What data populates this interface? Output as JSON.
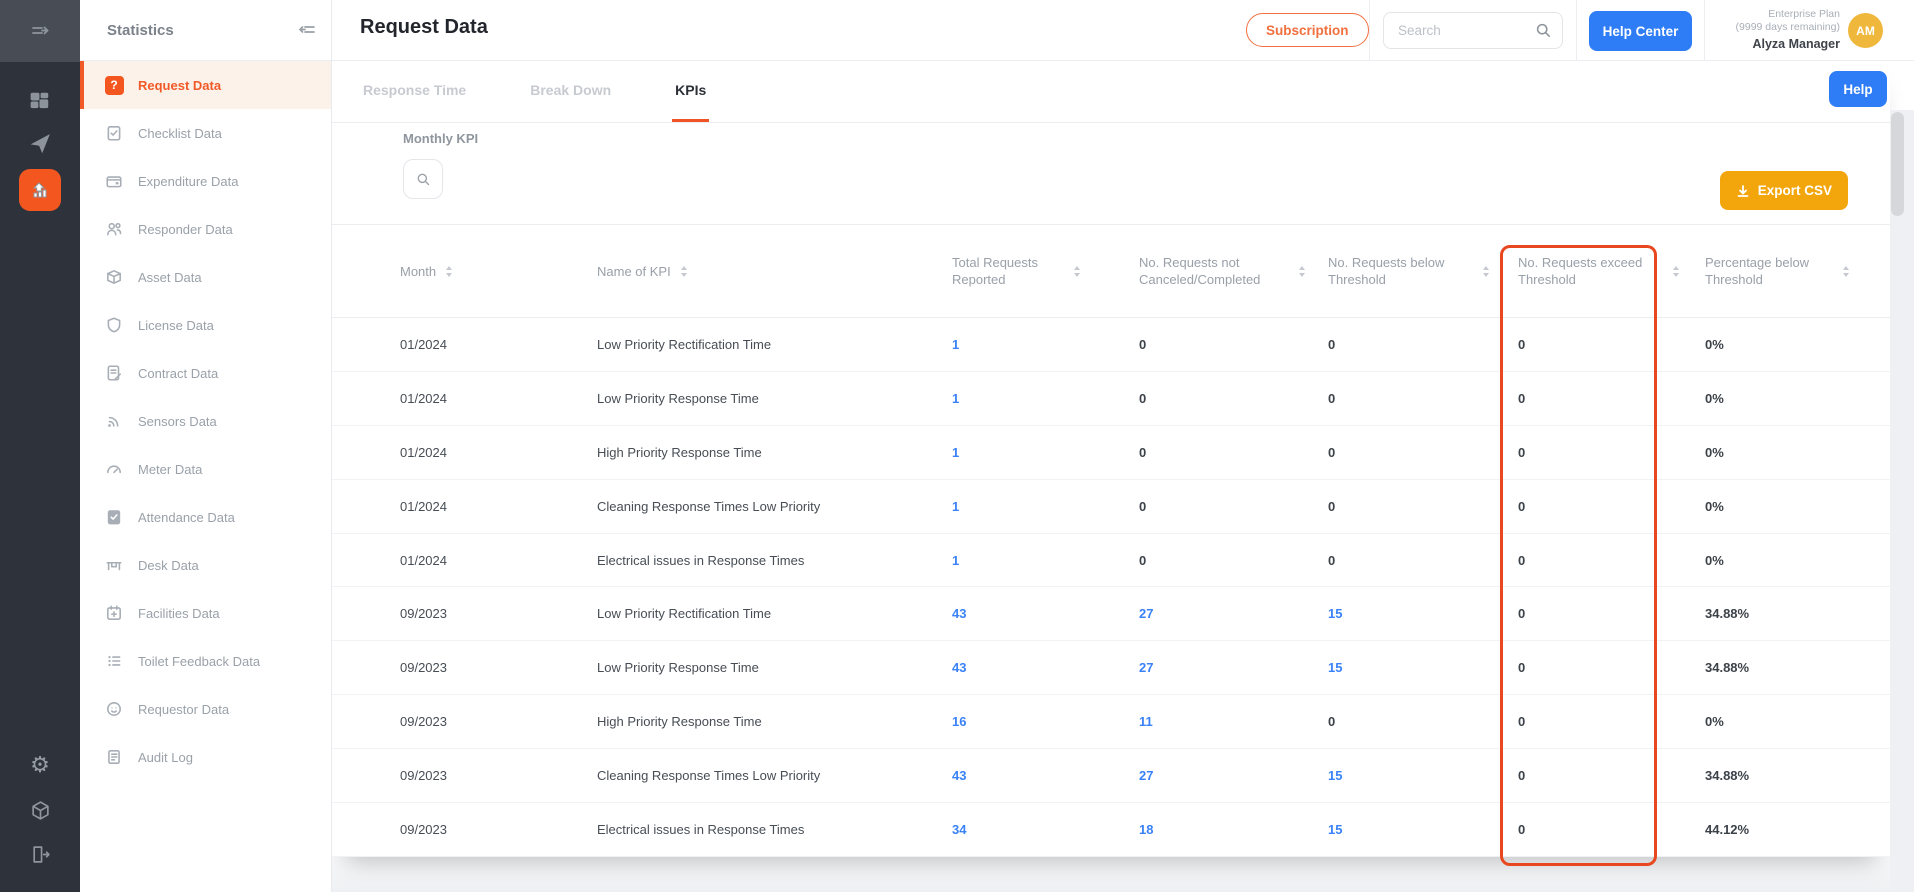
{
  "colors": {
    "accent_orange": "#f05a28",
    "highlight_box_red": "#e8481f",
    "link_blue": "#3a82f7",
    "primary_blue": "#2e7cf6",
    "export_amber": "#f3a60b",
    "avatar_amber": "#efb83c"
  },
  "rail": {
    "icons": [
      "sidebar-toggle",
      "dashboard",
      "send",
      "statistics",
      "settings",
      "modules",
      "logout"
    ],
    "active_icon": "statistics"
  },
  "sidebar": {
    "title": "Statistics",
    "items": [
      {
        "label": "Request Data",
        "icon": "request",
        "active": true
      },
      {
        "label": "Checklist Data",
        "icon": "checklist",
        "active": false
      },
      {
        "label": "Expenditure Data",
        "icon": "expenditure",
        "active": false
      },
      {
        "label": "Responder Data",
        "icon": "responder",
        "active": false
      },
      {
        "label": "Asset Data",
        "icon": "asset",
        "active": false
      },
      {
        "label": "License Data",
        "icon": "license",
        "active": false
      },
      {
        "label": "Contract Data",
        "icon": "contract",
        "active": false
      },
      {
        "label": "Sensors Data",
        "icon": "sensors",
        "active": false
      },
      {
        "label": "Meter Data",
        "icon": "meter",
        "active": false
      },
      {
        "label": "Attendance Data",
        "icon": "attendance",
        "active": false
      },
      {
        "label": "Desk Data",
        "icon": "desk",
        "active": false
      },
      {
        "label": "Facilities Data",
        "icon": "facilities",
        "active": false
      },
      {
        "label": "Toilet Feedback Data",
        "icon": "toilet",
        "active": false
      },
      {
        "label": "Requestor Data",
        "icon": "requestor",
        "active": false
      },
      {
        "label": "Audit Log",
        "icon": "audit",
        "active": false
      }
    ]
  },
  "header": {
    "title": "Request Data",
    "subscription": "Subscription",
    "search_placeholder": "Search",
    "help_center": "Help Center",
    "plan_name": "Enterprise Plan",
    "plan_days": "(9999 days remaining)",
    "user_name": "Alyza Manager",
    "avatar_initials": "AM",
    "help": "Help"
  },
  "tabs": [
    {
      "label": "Response Time",
      "active": false
    },
    {
      "label": "Break Down",
      "active": false
    },
    {
      "label": "KPIs",
      "active": true
    }
  ],
  "content": {
    "section_title": "Monthly KPI",
    "export_label": "Export CSV"
  },
  "table": {
    "columns": [
      "Month",
      "Name of KPI",
      "Total Requests Reported",
      "No. Requests not Canceled/Completed",
      "No. Requests below Threshold",
      "No. Requests exceed Threshold",
      "Percentage below Threshold"
    ],
    "highlighted_column": "No. Requests exceed Threshold",
    "rows": [
      [
        "01/2024",
        "Low Priority Rectification Time",
        "1",
        "0",
        "0",
        "0",
        "0%"
      ],
      [
        "01/2024",
        "Low Priority Response Time",
        "1",
        "0",
        "0",
        "0",
        "0%"
      ],
      [
        "01/2024",
        "High Priority Response Time",
        "1",
        "0",
        "0",
        "0",
        "0%"
      ],
      [
        "01/2024",
        "Cleaning Response Times Low Priority",
        "1",
        "0",
        "0",
        "0",
        "0%"
      ],
      [
        "01/2024",
        "Electrical issues in Response Times",
        "1",
        "0",
        "0",
        "0",
        "0%"
      ],
      [
        "09/2023",
        "Low Priority Rectification Time",
        "43",
        "27",
        "15",
        "0",
        "34.88%"
      ],
      [
        "09/2023",
        "Low Priority Response Time",
        "43",
        "27",
        "15",
        "0",
        "34.88%"
      ],
      [
        "09/2023",
        "High Priority Response Time",
        "16",
        "11",
        "0",
        "0",
        "0%"
      ],
      [
        "09/2023",
        "Cleaning Response Times Low Priority",
        "43",
        "27",
        "15",
        "0",
        "34.88%"
      ],
      [
        "09/2023",
        "Electrical issues in Response Times",
        "34",
        "18",
        "15",
        "0",
        "44.12%"
      ]
    ]
  }
}
